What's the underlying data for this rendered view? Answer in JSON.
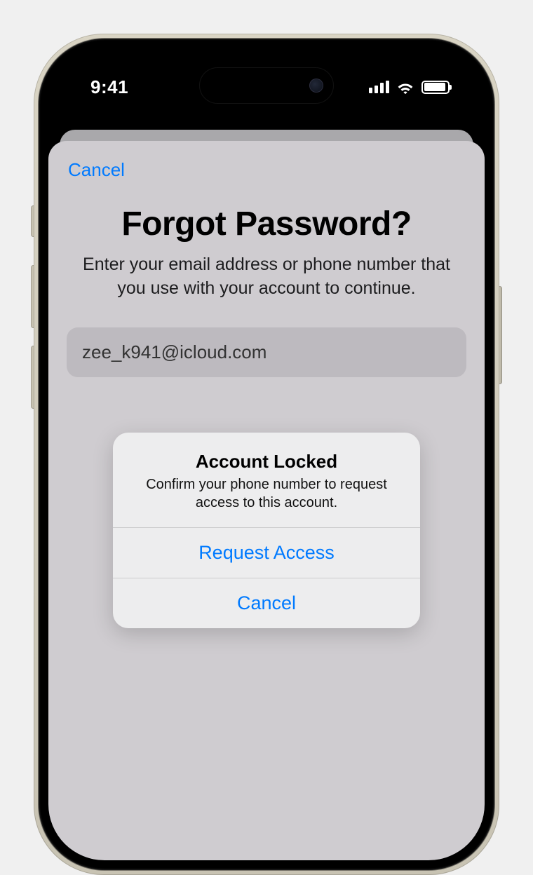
{
  "status": {
    "time": "9:41"
  },
  "sheet": {
    "cancel_label": "Cancel",
    "title": "Forgot Password?",
    "description": "Enter your email address or phone number that you use with your account to continue.",
    "email_value": "zee_k941@icloud.com"
  },
  "alert": {
    "title": "Account Locked",
    "message": "Confirm your phone number to request access to this account.",
    "primary_button": "Request Access",
    "cancel_button": "Cancel"
  }
}
